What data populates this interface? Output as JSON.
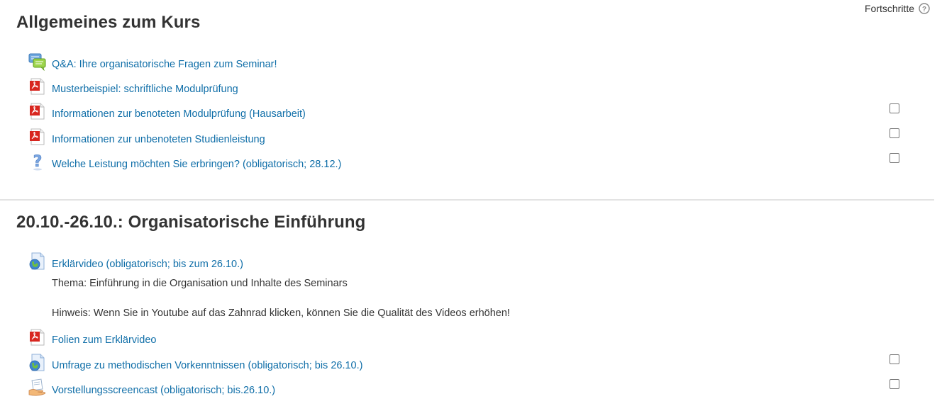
{
  "header": {
    "progress_label": "Fortschritte",
    "help_icon": "help-circle-icon"
  },
  "sections": [
    {
      "title": "Allgemeines zum Kurs",
      "activities": [
        {
          "label": "Q&A: Ihre organisatorische Fragen zum Seminar!",
          "icon": "forum-icon",
          "completion": false
        },
        {
          "label": "Musterbeispiel: schriftliche Modulprüfung",
          "icon": "pdf-icon",
          "completion": false
        },
        {
          "label": "Informationen zur benoteten Modulprüfung (Hausarbeit)",
          "icon": "pdf-icon",
          "completion": true,
          "checked": false
        },
        {
          "label": "Informationen zur unbenoteten Studienleistung",
          "icon": "pdf-icon",
          "completion": true,
          "checked": false
        },
        {
          "label": "Welche Leistung möchten Sie erbringen? (obligatorisch; 28.12.)",
          "icon": "question-icon",
          "completion": true,
          "checked": false
        }
      ]
    },
    {
      "title": "20.10.-26.10.: Organisatorische Einführung",
      "activities": [
        {
          "label": "Erklärvideo (obligatorisch; bis zum 26.10.)",
          "icon": "url-globe-icon",
          "completion": false,
          "description": [
            "Thema: Einführung in die Organisation und Inhalte des Seminars",
            "Hinweis: Wenn Sie in Youtube auf das Zahnrad klicken, können Sie die Qualität des Videos erhöhen!"
          ]
        },
        {
          "label": "Folien zum Erklärvideo",
          "icon": "pdf-icon",
          "completion": false
        },
        {
          "label": "Umfrage zu methodischen Vorkenntnissen (obligatorisch; bis 26.10.)",
          "icon": "url-globe-icon",
          "completion": true,
          "checked": false
        },
        {
          "label": "Vorstellungsscreencast (obligatorisch; bis.26.10.)",
          "icon": "assignment-hand-icon",
          "completion": true,
          "checked": false
        }
      ]
    }
  ],
  "colors": {
    "link": "#0f6ea8",
    "text": "#333333",
    "divider": "#e3e3e3",
    "pdf_red": "#d8261f",
    "forum_green": "#8cc63f",
    "question_blue": "#6f9bd8"
  }
}
